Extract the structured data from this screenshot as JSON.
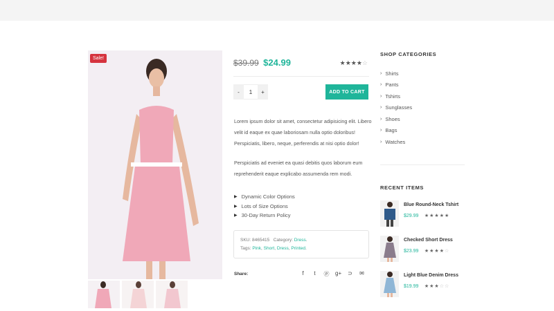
{
  "product": {
    "sale_badge": "Sale!",
    "old_price": "$39.99",
    "new_price": "$24.99",
    "rating": 3.5,
    "quantity": {
      "minus": "-",
      "value": "1",
      "plus": "+"
    },
    "add_to_cart": "ADD TO CART",
    "description": [
      "Lorem ipsum dolor sit amet, consectetur adipisicing elit. Libero velit id eaque ex quae laboriosam nulla optio doloribus! Perspiciatis, libero, neque, perferendis at nisi optio dolor!",
      "Perspiciatis ad eveniet ea quasi debitis quos laborum eum reprehenderit eaque explicabo assumenda rem modi."
    ],
    "features": [
      "Dynamic Color Options",
      "Lots of Size Options",
      "30-Day Return Policy"
    ],
    "sku_label": "SKU:",
    "sku": "8465415",
    "category_label": "Category:",
    "category": "Dress",
    "tags_label": "Tags:",
    "tags": [
      "Pink",
      "Short",
      "Dress",
      "Printed"
    ],
    "share_label": "Share:",
    "share_icons": [
      "facebook-icon",
      "twitter-icon",
      "pinterest-icon",
      "google-plus-icon",
      "rss-icon",
      "email-icon"
    ]
  },
  "sidebar": {
    "categories_title": "SHOP CATEGORIES",
    "categories": [
      "Shirts",
      "Pants",
      "Tshirts",
      "Sunglasses",
      "Shoes",
      "Bags",
      "Watches"
    ],
    "recent_title": "RECENT ITEMS",
    "recent_items": [
      {
        "name": "Blue Round-Neck Tshirt",
        "price": "$29.99",
        "rating": 4.5
      },
      {
        "name": "Checked Short Dress",
        "price": "$23.99",
        "rating": 3.5
      },
      {
        "name": "Light Blue Denim Dress",
        "price": "$19.99",
        "rating": 3
      }
    ]
  },
  "colors": {
    "accent": "#1fb59a",
    "sale": "#d5333e",
    "dress": "#f0a8b8"
  }
}
